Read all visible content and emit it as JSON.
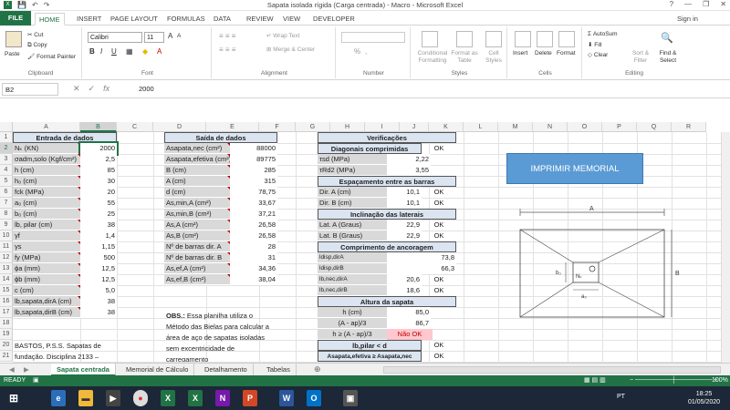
{
  "window": {
    "title": "Sapata isolada rígida (Carga centrada) - Macro - Microsoft Excel",
    "minimize": "—",
    "restore": "❐",
    "close": "✕",
    "help": "?",
    "signin": "Sign in"
  },
  "ribbon_tabs": [
    "FILE",
    "HOME",
    "INSERT",
    "PAGE LAYOUT",
    "FORMULAS",
    "DATA",
    "REVIEW",
    "VIEW",
    "DEVELOPER"
  ],
  "ribbon": {
    "clipboard": {
      "paste": "Paste",
      "cut": "Cut",
      "copy": "Copy",
      "format_painter": "Format Painter",
      "label": "Clipboard"
    },
    "font": {
      "name": "Calibri",
      "size": "11",
      "bold": "B",
      "italic": "I",
      "underline": "U",
      "grow": "A",
      "shrink": "A",
      "label": "Font"
    },
    "alignment": {
      "wrap": "Wrap Text",
      "merge": "Merge & Center",
      "label": "Alignment"
    },
    "number": {
      "format": "",
      "pct": "%",
      "comma": ",",
      "label": "Number"
    },
    "styles": {
      "conditional": "Conditional Formatting",
      "table": "Format as Table",
      "cell": "Cell Styles",
      "label": "Styles"
    },
    "cells": {
      "insert": "Insert",
      "delete": "Delete",
      "format": "Format",
      "label": "Cells"
    },
    "editing": {
      "autosum": "AutoSum",
      "fill": "Fill",
      "clear": "Clear",
      "sort": "Sort & Filter",
      "find": "Find & Select",
      "label": "Editing"
    }
  },
  "formula_bar": {
    "name_box": "B2",
    "value": "2000"
  },
  "columns": [
    "A",
    "B",
    "C",
    "D",
    "E",
    "F",
    "G",
    "H",
    "I",
    "J",
    "K",
    "L",
    "M",
    "N",
    "O",
    "P",
    "Q",
    "R"
  ],
  "rows": [
    "1",
    "2",
    "3",
    "4",
    "5",
    "6",
    "7",
    "8",
    "9",
    "10",
    "11",
    "12",
    "13",
    "14",
    "15",
    "16",
    "17",
    "18",
    "19",
    "20",
    "21"
  ],
  "entrada": {
    "header": "Entrada de dados",
    "rows": [
      {
        "label": "Nₖ (KN)",
        "value": "2000"
      },
      {
        "label": "σadm,solo (Kgf/cm²)",
        "value": "2,5"
      },
      {
        "label": "h (cm)",
        "value": "85"
      },
      {
        "label": "h₀ (cm)",
        "value": "30"
      },
      {
        "label": "fck (MPa)",
        "value": "20"
      },
      {
        "label": "a₀ (cm)",
        "value": "55"
      },
      {
        "label": "b₀ (cm)",
        "value": "25"
      },
      {
        "label": "lb, pilar (cm)",
        "value": "38"
      },
      {
        "label": "γf",
        "value": "1,4"
      },
      {
        "label": "γs",
        "value": "1,15"
      },
      {
        "label": "fy (MPa)",
        "value": "500"
      },
      {
        "label": "ϕa (mm)",
        "value": "12,5"
      },
      {
        "label": "ϕb (mm)",
        "value": "12,5"
      },
      {
        "label": "c (cm)",
        "value": "5,0"
      },
      {
        "label": "lb,sapata,dirA (cm)",
        "value": "38"
      },
      {
        "label": "lb,sapata,dirB (cm)",
        "value": "38"
      }
    ]
  },
  "saida": {
    "header": "Saída de dados",
    "rows": [
      {
        "label": "Asapata,nec (cm²)",
        "value": "88000"
      },
      {
        "label": "Asapata,efetiva (cm²)",
        "value": "89775"
      },
      {
        "label": "B (cm)",
        "value": "285"
      },
      {
        "label": "A (cm)",
        "value": "315"
      },
      {
        "label": "d (cm)",
        "value": "78,75"
      },
      {
        "label": "As,min,A (cm²)",
        "value": "33,67"
      },
      {
        "label": "As,min,B (cm²)",
        "value": "37,21"
      },
      {
        "label": "As,A (cm²)",
        "value": "26,58"
      },
      {
        "label": "As,B (cm²)",
        "value": "26,58"
      },
      {
        "label": "Nº de barras dir. A",
        "value": "28"
      },
      {
        "label": "Nº de barras dir. B",
        "value": "31"
      },
      {
        "label": "As,ef,A (cm²)",
        "value": "34,36"
      },
      {
        "label": "As,ef,B (cm²)",
        "value": "38,04"
      }
    ]
  },
  "verificacoes": {
    "header": "Verificações",
    "diag_header": "Diagonais comprimidas",
    "diag_ok": "OK",
    "tsd": {
      "label": "τsd (MPa)",
      "value": "2,22"
    },
    "trd2": {
      "label": "τRd2 (MPa)",
      "value": "3,55"
    },
    "esp_header": "Espaçamento entre as barras",
    "dirA": {
      "label": "Dir. A (cm)",
      "value": "10,1",
      "status": "OK"
    },
    "dirB": {
      "label": "Dir. B (cm)",
      "value": "10,1",
      "status": "OK"
    },
    "incl_header": "Inclinação das laterais",
    "latA": {
      "label": "Lat. A (Graus)",
      "value": "22,9",
      "status": "OK"
    },
    "latB": {
      "label": "Lat. B (Graus)",
      "value": "22,9",
      "status": "OK"
    },
    "anc_header": "Comprimento de ancoragem",
    "ldispA": {
      "label": "ldisp,dirA",
      "value": "73,8"
    },
    "ldispB": {
      "label": "ldisp,dirB",
      "value": "66,3"
    },
    "lbnecA": {
      "label": "lb,nec,dirA",
      "value": "20,6",
      "status": "OK"
    },
    "lbnecB": {
      "label": "lb,nec,dirB",
      "value": "18,6",
      "status": "OK"
    },
    "alt_header": "Altura da sapata",
    "h": {
      "label": "h (cm)",
      "value": "85,0"
    },
    "aap": {
      "label": "(A - ap)/3",
      "value": "86,7"
    },
    "cmp": {
      "label": "h ≥ (A - ap)/3",
      "status": "Não OK"
    },
    "lbpilar": {
      "label": "lb,pilar < d",
      "status": "OK"
    },
    "asapata": {
      "label": "Asapata,efetiva ≥ Asapata,nec",
      "status": "OK"
    }
  },
  "notes": {
    "obs_bold": "OBS.:",
    "obs": " Essa planilha utiliza o Método das Bielas para calcular a área de aço de sapatas isoladas sem excentricidade de carregamento",
    "ref": "BASTOS, P.S.S. Sapatas de fundação. Disciplina 2133 –"
  },
  "button": {
    "label": "IMPRIMIR MEMORIAL"
  },
  "drawing": {
    "A": "A",
    "B": "B",
    "b0": "b₀",
    "a0": "a₀",
    "nk": "Nₖ"
  },
  "sheets": [
    "Sapata centrada",
    "Memorial de Cálculo",
    "Detalhamento",
    "Tabelas"
  ],
  "status": {
    "ready": "READY",
    "zoom": "100%"
  },
  "taskbar": {
    "time": "18:25",
    "date": "01/05/2020",
    "lang": "PT"
  }
}
